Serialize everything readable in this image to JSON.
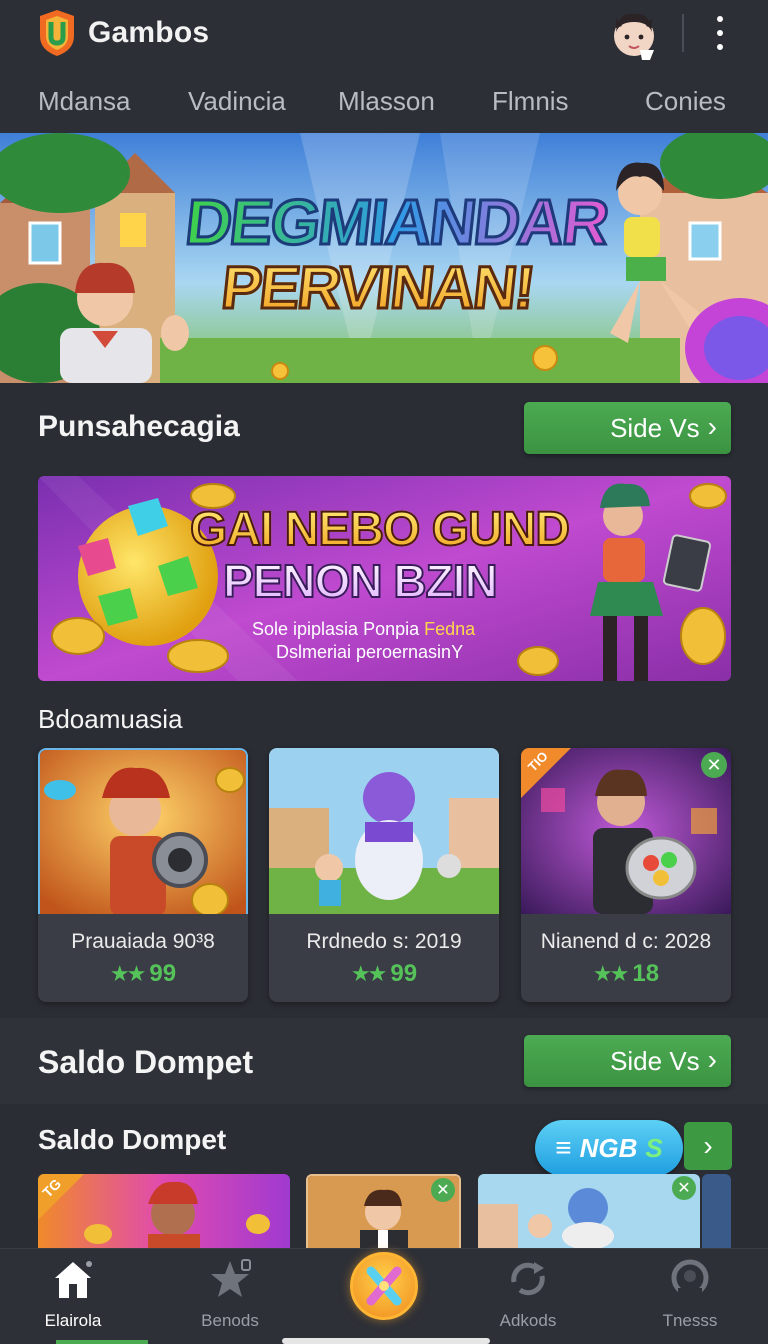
{
  "app": {
    "name": "Gambos"
  },
  "tabs": [
    "Mdansa",
    "Vadincia",
    "Mlasson",
    "Flmnis",
    "Conies"
  ],
  "hero": {
    "line1": "DEGMIANDAR",
    "line2": "PERVINAN!"
  },
  "section1": {
    "title": "Punsahecagia",
    "button_label": "Side Vs",
    "button_chevron": "›"
  },
  "promo": {
    "line1": "GAI NEBO GUND",
    "line2": "PENON BZIN",
    "sub1": "Sole ipiplasia Ponpia",
    "sub1_accent": "Fedna",
    "sub2": "Dslmeriai peroernasinY"
  },
  "section2": {
    "title": "Bdoamuasia"
  },
  "cards": [
    {
      "title": "Prauaiada 90³8",
      "stars": "★★",
      "rating": "99"
    },
    {
      "title": "Rrdnedo s: 2019",
      "stars": "★★",
      "rating": "99"
    },
    {
      "title": "Nianend d c: 2028",
      "stars": "★★",
      "rating": "18"
    }
  ],
  "card_badges": {
    "badge3_tag": "TIO"
  },
  "section3": {
    "title": "Saldo Dompet",
    "button_label": "Side Vs",
    "button_chevron": "›"
  },
  "section4": {
    "title": "Saldo Dompet",
    "pill_label": "NGB",
    "pill_suffix": "S",
    "pill_icon": "≡",
    "arrow": "›"
  },
  "thumb_badges": {
    "first_tag": "TG"
  },
  "bottom_nav": [
    {
      "label": "Elairola",
      "icon": "home-icon",
      "active": true
    },
    {
      "label": "Benods",
      "icon": "star-icon",
      "active": false
    },
    {
      "label": "",
      "icon": "center-x-icon",
      "active": false
    },
    {
      "label": "Adkods",
      "icon": "sync-icon",
      "active": false
    },
    {
      "label": "Tnesss",
      "icon": "profile-icon",
      "active": false
    }
  ],
  "colors": {
    "background": "#2a2d34",
    "accent_green": "#4cab52",
    "star_green": "#55c25a",
    "pill_blue": "#1f9ee0"
  }
}
